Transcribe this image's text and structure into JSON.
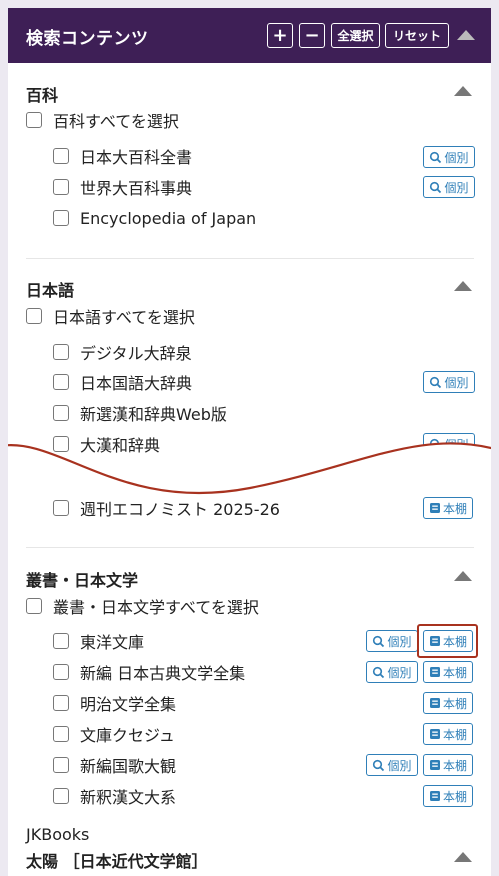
{
  "header": {
    "title": "検索コンテンツ",
    "plus": "+",
    "minus": "−",
    "select_all": "全選択",
    "reset": "リセット"
  },
  "tags": {
    "kobetsu": "個別",
    "hondana": "本棚"
  },
  "sections": {
    "hyakka": {
      "title": "百科",
      "select_all": "百科すべてを選択",
      "items": [
        "日本大百科全書",
        "世界大百科事典",
        "Encyclopedia of Japan"
      ]
    },
    "nihongo": {
      "title": "日本語",
      "select_all": "日本語すべてを選択",
      "items": [
        "デジタル大辞泉",
        "日本国語大辞典",
        "新選漢和辞典Web版",
        "大漢和辞典"
      ]
    },
    "weekly": {
      "items": [
        "週刊エコノミスト 2025-26"
      ]
    },
    "sosho": {
      "title": "叢書・日本文学",
      "select_all": "叢書・日本文学すべてを選択",
      "items": [
        "東洋文庫",
        "新編 日本古典文学全集",
        "明治文学全集",
        "文庫クセジュ",
        "新編国歌大観",
        "新釈漢文大系"
      ]
    },
    "jk": {
      "label": "JKBooks",
      "title": "太陽 ［日本近代文学館］"
    }
  }
}
